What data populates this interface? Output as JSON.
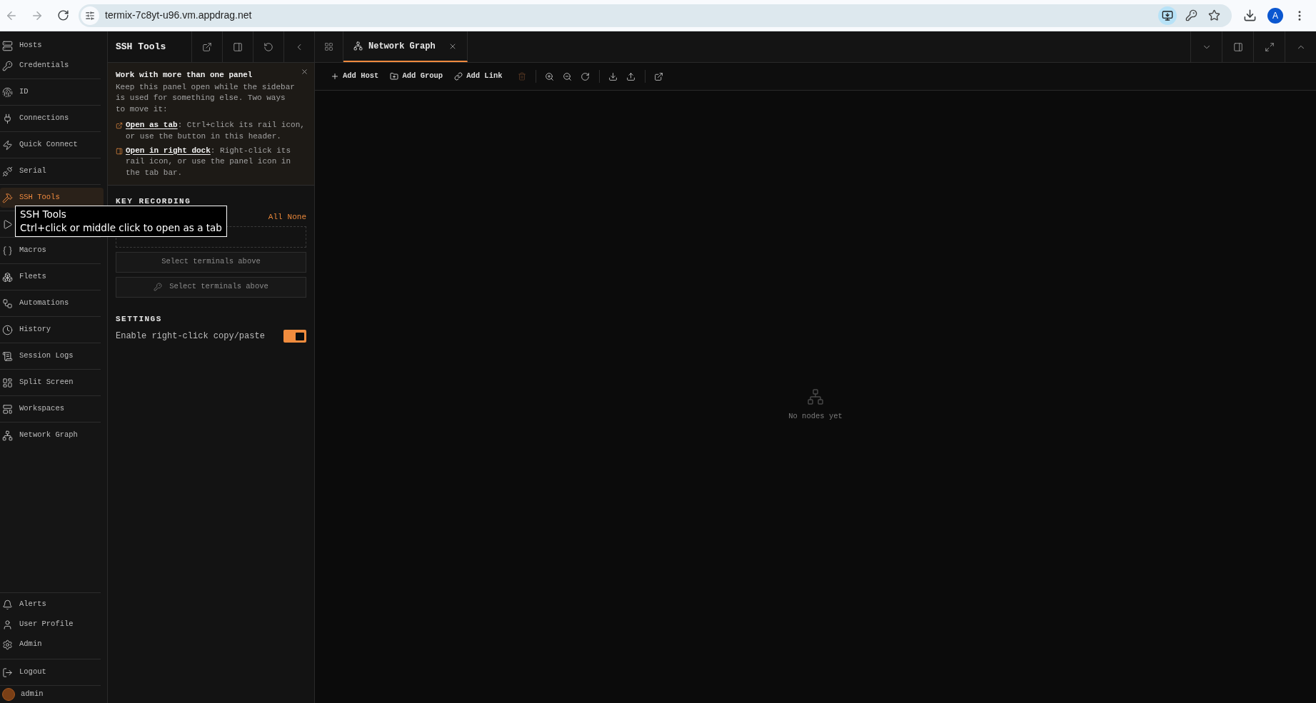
{
  "browser": {
    "url": "termix-7c8yt-u96.vm.appdrag.net",
    "profile_initial": "A"
  },
  "rail": {
    "items": [
      {
        "label": "Hosts",
        "selected": false
      },
      {
        "label": "Credentials",
        "selected": false
      },
      {
        "label": "ID",
        "selected": false
      },
      {
        "label": "Connections",
        "selected": false
      },
      {
        "label": "Quick Connect",
        "selected": false
      },
      {
        "label": "Serial",
        "selected": false
      },
      {
        "label": "SSH Tools",
        "selected": true
      },
      {
        "selected": false
      },
      {
        "label": "Macros",
        "selected": false
      },
      {
        "label": "Fleets",
        "selected": false
      },
      {
        "label": "Automations",
        "selected": false
      },
      {
        "label": "History",
        "selected": false
      },
      {
        "label": "Session Logs",
        "selected": false
      },
      {
        "label": "Split Screen",
        "selected": false
      },
      {
        "label": "Workspaces",
        "selected": false
      },
      {
        "label": "Network Graph",
        "selected": false
      }
    ],
    "footer_items": [
      {
        "label": "Alerts"
      },
      {
        "label": "User Profile"
      },
      {
        "label": "Admin"
      }
    ],
    "logout": "Logout",
    "user": "admin"
  },
  "tooltip": {
    "title": "SSH Tools",
    "hint": "Ctrl+click or middle click to open as a tab"
  },
  "panel": {
    "title": "SSH Tools",
    "notice": {
      "title": "Work with more than one panel",
      "body": "Keep this panel open while the sidebar is used for something else. Two ways to move it:",
      "tips": [
        {
          "link": "Open as tab",
          "text": ": Ctrl+click its rail icon, or use the button in this header."
        },
        {
          "link": "Open in right dock",
          "text": ": Right-click its rail icon, or use the panel icon in the tab bar."
        }
      ]
    },
    "key_recording": {
      "heading": "KEY RECORDING",
      "select_all": "All",
      "select_none": "None",
      "buttons": [
        {
          "kind": "plain",
          "label": "Select terminals above"
        },
        {
          "kind": "key",
          "label": "Select terminals above"
        }
      ]
    },
    "settings": {
      "heading": "SETTINGS",
      "options": [
        {
          "label": "Enable right-click copy/paste",
          "on": true
        }
      ]
    }
  },
  "tabs": [
    {
      "label": "Network Graph",
      "selected": true
    }
  ],
  "toolbar": {
    "actions": [
      {
        "label": "Add Host"
      },
      {
        "label": "Add Group"
      },
      {
        "label": "Add Link"
      }
    ],
    "delete": {
      "disabled": true
    }
  },
  "canvas": {
    "empty_message": "No nodes yet"
  }
}
